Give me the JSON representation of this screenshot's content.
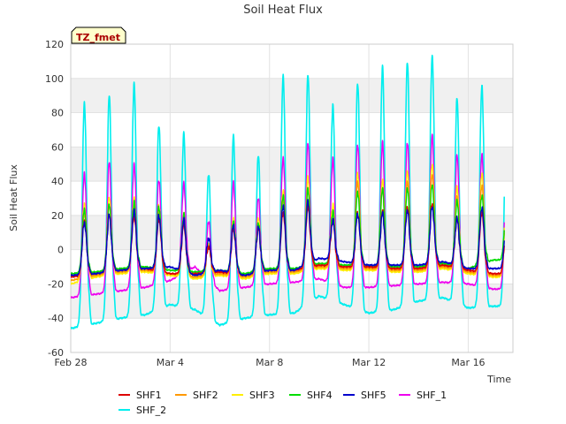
{
  "chart_data": {
    "type": "line",
    "title": "Soil Heat Flux",
    "xlabel": "Time",
    "ylabel": "Soil Heat Flux",
    "badge": "TZ_fmet",
    "xlim": [
      0,
      17.8
    ],
    "ylim": [
      -60,
      120
    ],
    "yticks": [
      -60,
      -40,
      -20,
      0,
      20,
      40,
      60,
      80,
      100,
      120
    ],
    "xticks": [
      {
        "value": 0,
        "label": "Feb 28"
      },
      {
        "value": 4,
        "label": "Mar 4"
      },
      {
        "value": 8,
        "label": "Mar 8"
      },
      {
        "value": 12,
        "label": "Mar 12"
      },
      {
        "value": 16,
        "label": "Mar 16"
      }
    ],
    "legend": "bottom",
    "band_color": "#f0f0f0",
    "x_start": 0,
    "x_end": 17.45,
    "peak_phase": 0.55,
    "series": [
      {
        "name": "SHF1",
        "color": "#dd0000",
        "night": [
          -16,
          -14,
          -12,
          -11,
          -14,
          -14,
          -13,
          -15,
          -12,
          -12,
          -9,
          -10,
          -10,
          -11,
          -11,
          -9,
          -12,
          -14
        ],
        "peaks": [
          17,
          20,
          20,
          18,
          15,
          2,
          12,
          12,
          22,
          25,
          17,
          22,
          22,
          25,
          27,
          18,
          22
        ]
      },
      {
        "name": "SHF2",
        "color": "#ff9900",
        "night": [
          -18,
          -15,
          -13,
          -12,
          -14,
          -16,
          -14,
          -16,
          -13,
          -13,
          -10,
          -11,
          -11,
          -12,
          -12,
          -10,
          -13,
          -15
        ],
        "peaks": [
          22,
          25,
          25,
          22,
          18,
          3,
          15,
          14,
          30,
          35,
          22,
          40,
          35,
          40,
          44,
          30,
          38
        ]
      },
      {
        "name": "SHF3",
        "color": "#ffee00",
        "night": [
          -20,
          -16,
          -14,
          -13,
          -15,
          -17,
          -15,
          -17,
          -14,
          -14,
          -11,
          -12,
          -12,
          -13,
          -13,
          -11,
          -14,
          -16
        ],
        "peaks": [
          27,
          30,
          30,
          26,
          20,
          4,
          18,
          18,
          35,
          42,
          26,
          45,
          40,
          46,
          50,
          36,
          45
        ]
      },
      {
        "name": "SHF4",
        "color": "#00dd00",
        "night": [
          -14,
          -13,
          -11,
          -10,
          -12,
          -13,
          -12,
          -14,
          -11,
          -11,
          -8,
          -9,
          -9,
          -10,
          -10,
          -8,
          -11,
          -6
        ],
        "peaks": [
          24,
          26,
          28,
          25,
          20,
          2,
          16,
          15,
          32,
          35,
          22,
          34,
          35,
          36,
          38,
          28,
          32
        ]
      },
      {
        "name": "SHF5",
        "color": "#0000cc",
        "night": [
          -15,
          -14,
          -12,
          -11,
          -10,
          -15,
          -12,
          -15,
          -12,
          -12,
          -5,
          -7,
          -9,
          -9,
          -9,
          -7,
          -11,
          -11
        ],
        "peaks": [
          16,
          20,
          23,
          20,
          17,
          7,
          14,
          13,
          26,
          28,
          17,
          21,
          21,
          23,
          25,
          18,
          25
        ]
      },
      {
        "name": "SHF_1",
        "color": "#ee00ee",
        "night": [
          -28,
          -26,
          -24,
          -22,
          -18,
          -10,
          -24,
          -22,
          -20,
          -19,
          -17,
          -22,
          -22,
          -21,
          -20,
          -19,
          -20,
          -23
        ],
        "peaks": [
          45,
          51,
          50,
          41,
          38,
          17,
          39,
          30,
          54,
          62,
          53,
          62,
          62,
          63,
          67,
          55,
          56
        ]
      },
      {
        "name": "SHF_2",
        "color": "#00eeee",
        "night": [
          -46,
          -43,
          -40,
          -38,
          -32,
          -35,
          -44,
          -40,
          -38,
          -37,
          -27,
          -32,
          -37,
          -35,
          -30,
          -28,
          -34,
          -33
        ],
        "peaks": [
          86,
          90,
          97,
          73,
          67,
          45,
          66,
          55,
          102,
          102,
          84,
          98,
          106,
          110,
          113,
          88,
          96
        ]
      }
    ]
  }
}
